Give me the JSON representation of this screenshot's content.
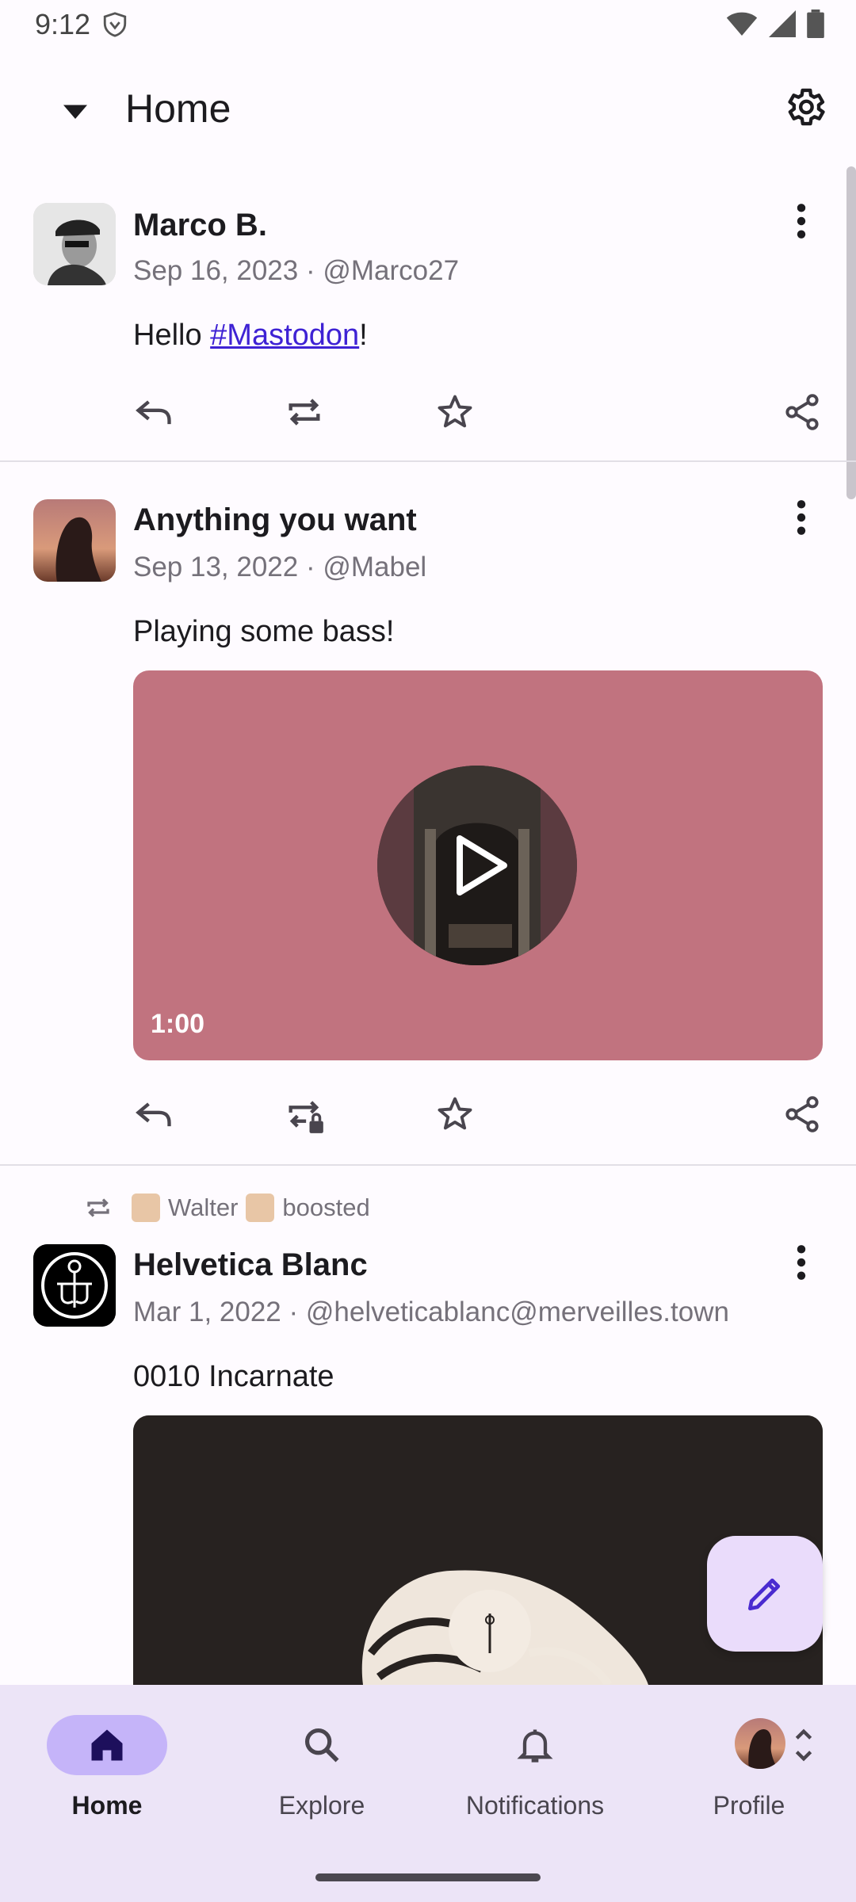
{
  "status_bar": {
    "time": "9:12"
  },
  "app_bar": {
    "title": "Home"
  },
  "posts": [
    {
      "author": "Marco B.",
      "meta": "Sep 16, 2023 · @Marco27",
      "content_prefix": "Hello ",
      "content_link": "#Mastodon",
      "content_suffix": "!"
    },
    {
      "author": "Anything you want",
      "meta": "Sep 13, 2022 · @Mabel",
      "content": "Playing some bass!",
      "video_duration": "1:00"
    },
    {
      "boost_user": "Walter",
      "boost_text": "boosted",
      "author": "Helvetica Blanc",
      "meta": "Mar 1, 2022 · @helveticablanc@merveilles.town",
      "content": "0010 Incarnate"
    }
  ],
  "bottom_nav": {
    "items": [
      {
        "label": "Home",
        "icon": "home-icon",
        "selected": true
      },
      {
        "label": "Explore",
        "icon": "search-icon",
        "selected": false
      },
      {
        "label": "Notifications",
        "icon": "bell-icon",
        "selected": false
      },
      {
        "label": "Profile",
        "icon": "avatar",
        "selected": false
      }
    ]
  },
  "colors": {
    "accent": "#3e22d4",
    "nav_background": "#ece4f7",
    "nav_selected_pill": "#c5b4f9",
    "fab_background": "#eadcfb",
    "video_background": "#c1737f"
  }
}
